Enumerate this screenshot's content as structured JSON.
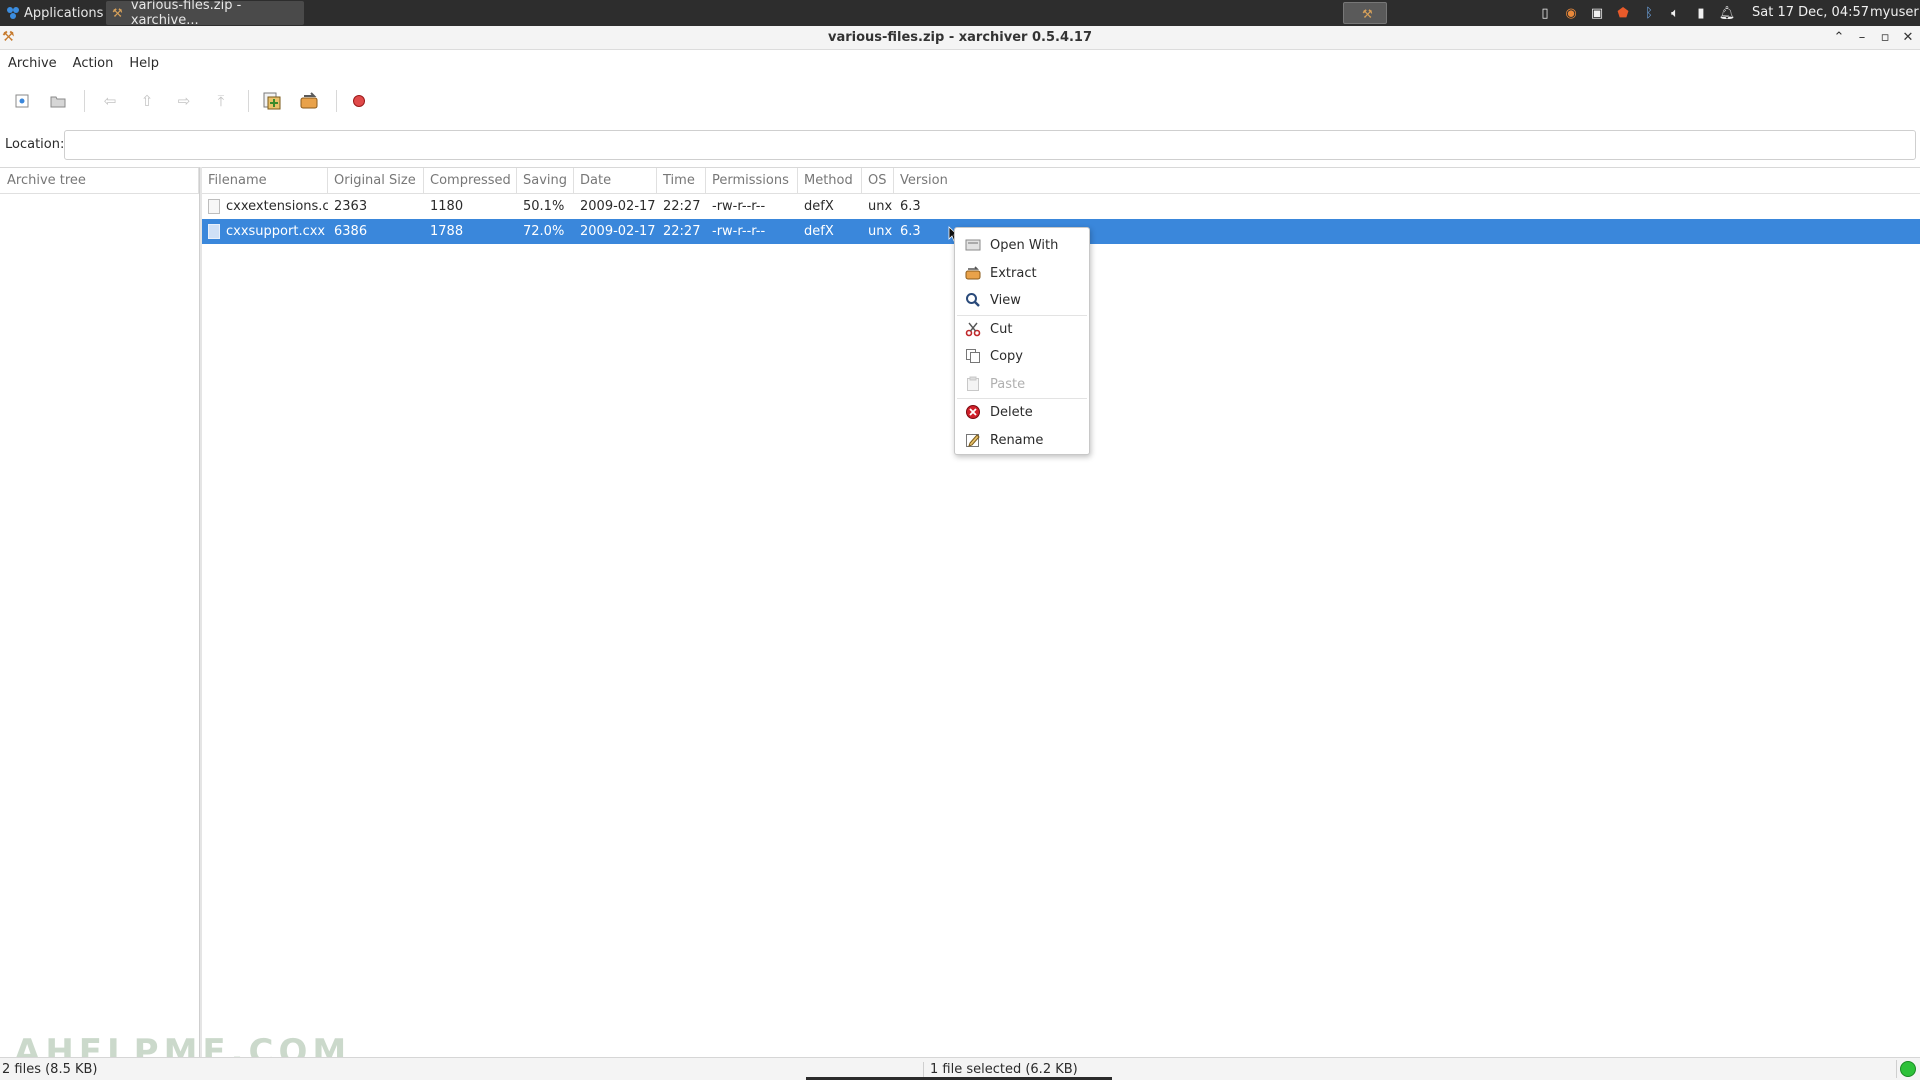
{
  "taskbar": {
    "applications_label": "Applications",
    "task_label": "various-files.zip - xarchive...",
    "clock": "Sat 17 Dec, 04:57",
    "user": "myuser"
  },
  "window": {
    "title": "various-files.zip - xarchiver 0.5.4.17"
  },
  "menu": {
    "archive": "Archive",
    "action": "Action",
    "help": "Help"
  },
  "location": {
    "label": "Location:",
    "value": ""
  },
  "tree": {
    "header": "Archive tree"
  },
  "columns": {
    "filename": "Filename",
    "original_size": "Original Size",
    "compressed": "Compressed",
    "saving": "Saving",
    "date": "Date",
    "time": "Time",
    "permissions": "Permissions",
    "method": "Method",
    "os": "OS",
    "version": "Version"
  },
  "files": [
    {
      "filename": "cxxextensions.c",
      "original_size": "2363",
      "compressed": "1180",
      "saving": "50.1%",
      "date": "2009-02-17",
      "time": "22:27",
      "permissions": "-rw-r--r--",
      "method": "defX",
      "os": "unx",
      "version": "6.3"
    },
    {
      "filename": "cxxsupport.cxx",
      "original_size": "6386",
      "compressed": "1788",
      "saving": "72.0%",
      "date": "2009-02-17",
      "time": "22:27",
      "permissions": "-rw-r--r--",
      "method": "defX",
      "os": "unx",
      "version": "6.3"
    }
  ],
  "context_menu": {
    "open_with": "Open With",
    "extract": "Extract",
    "view": "View",
    "cut": "Cut",
    "copy": "Copy",
    "paste": "Paste",
    "delete": "Delete",
    "rename": "Rename"
  },
  "status": {
    "left": "2 files  (8.5 KB)",
    "selection": "1 file selected (6.2 KB)"
  },
  "watermark": "AHELPME.COM",
  "colors": {
    "selection": "#3a87db",
    "taskbar": "#2d2d2d",
    "delete_icon": "#d0202a",
    "status_led": "#2ec13a"
  }
}
